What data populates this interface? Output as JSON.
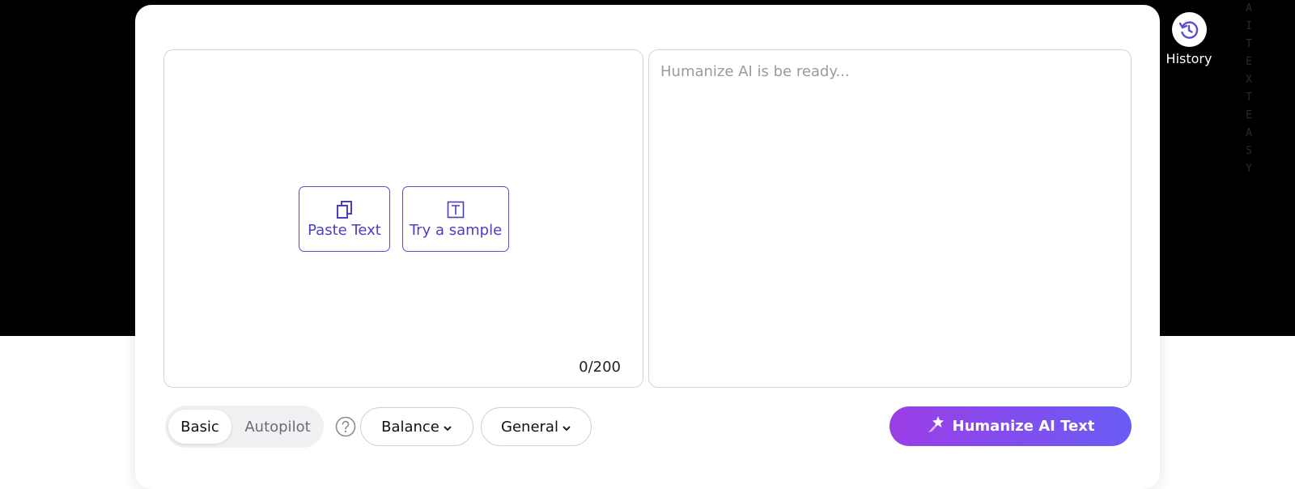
{
  "editor": {
    "output_placeholder": "Humanize AI is be ready...",
    "char_counter": "0/200",
    "paste_label": "Paste Text",
    "sample_label": "Try a sample"
  },
  "mode_toggle": {
    "options": [
      "Basic",
      "Autopilot"
    ],
    "selected": "Basic"
  },
  "dropdowns": {
    "level": "Balance",
    "purpose": "General"
  },
  "cta": {
    "label": "Humanize AI Text"
  },
  "history": {
    "label": "History"
  },
  "decor": {
    "side_letters": [
      "A",
      "I",
      "T",
      "E",
      "X",
      "T",
      "E",
      "A",
      "S",
      "Y"
    ]
  },
  "colors": {
    "accent": "#5b4fd1",
    "cta_start": "#9b3ee6",
    "cta_end": "#6a5cf5",
    "background_top": "#000000"
  },
  "icons": {
    "paste": "copy-icon",
    "sample": "text-box-icon",
    "help": "question-icon",
    "chevron": "chevron-down-icon",
    "cta": "sparkle-pin-icon",
    "history": "history-icon"
  }
}
